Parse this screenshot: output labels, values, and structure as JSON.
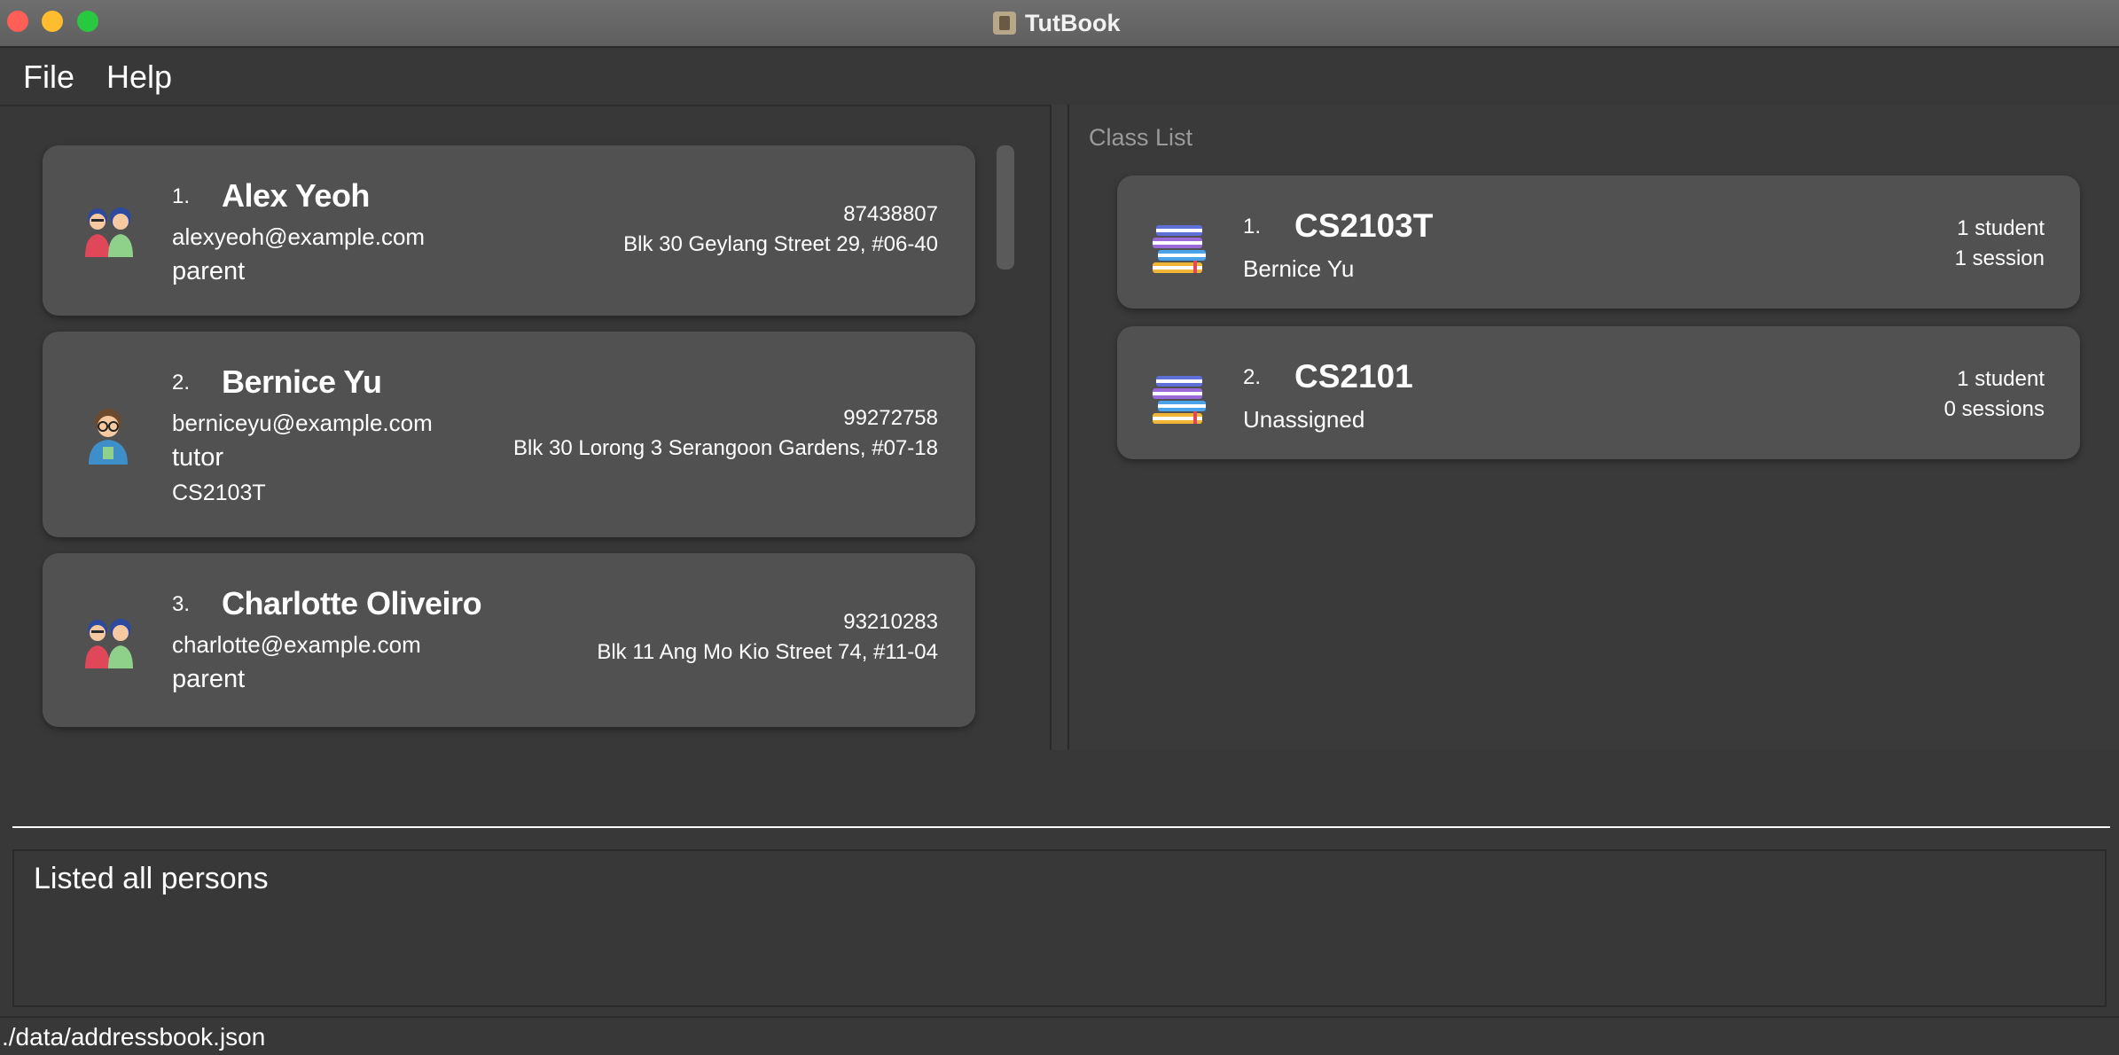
{
  "window": {
    "title": "TutBook"
  },
  "menu": {
    "file": "File",
    "help": "Help"
  },
  "persons": [
    {
      "index": "1.",
      "name": "Alex Yeoh",
      "email": "alexyeoh@example.com",
      "role": "parent",
      "class": "",
      "phone": "87438807",
      "address": "Blk 30 Geylang Street 29, #06-40",
      "icon": "parents-icon"
    },
    {
      "index": "2.",
      "name": "Bernice Yu",
      "email": "berniceyu@example.com",
      "role": "tutor",
      "class": "CS2103T",
      "phone": "99272758",
      "address": "Blk 30 Lorong 3 Serangoon Gardens, #07-18",
      "icon": "tutor-icon"
    },
    {
      "index": "3.",
      "name": "Charlotte Oliveiro",
      "email": "charlotte@example.com",
      "role": "parent",
      "class": "",
      "phone": "93210283",
      "address": "Blk 11 Ang Mo Kio Street 74, #11-04",
      "icon": "parents-icon"
    }
  ],
  "class_list": {
    "header": "Class List",
    "classes": [
      {
        "index": "1.",
        "name": "CS2103T",
        "tutor": "Bernice Yu",
        "students": "1 student",
        "sessions": "1 session",
        "icon": "books-icon"
      },
      {
        "index": "2.",
        "name": "CS2101",
        "tutor": "Unassigned",
        "students": "1 student",
        "sessions": "0 sessions",
        "icon": "books-icon"
      }
    ]
  },
  "command": {
    "value": "",
    "placeholder": ""
  },
  "result": {
    "message": "Listed all persons"
  },
  "status": {
    "path": "./data/addressbook.json"
  },
  "colors": {
    "background": "#383838",
    "card": "#515151",
    "muted": "#9a9a9a"
  }
}
